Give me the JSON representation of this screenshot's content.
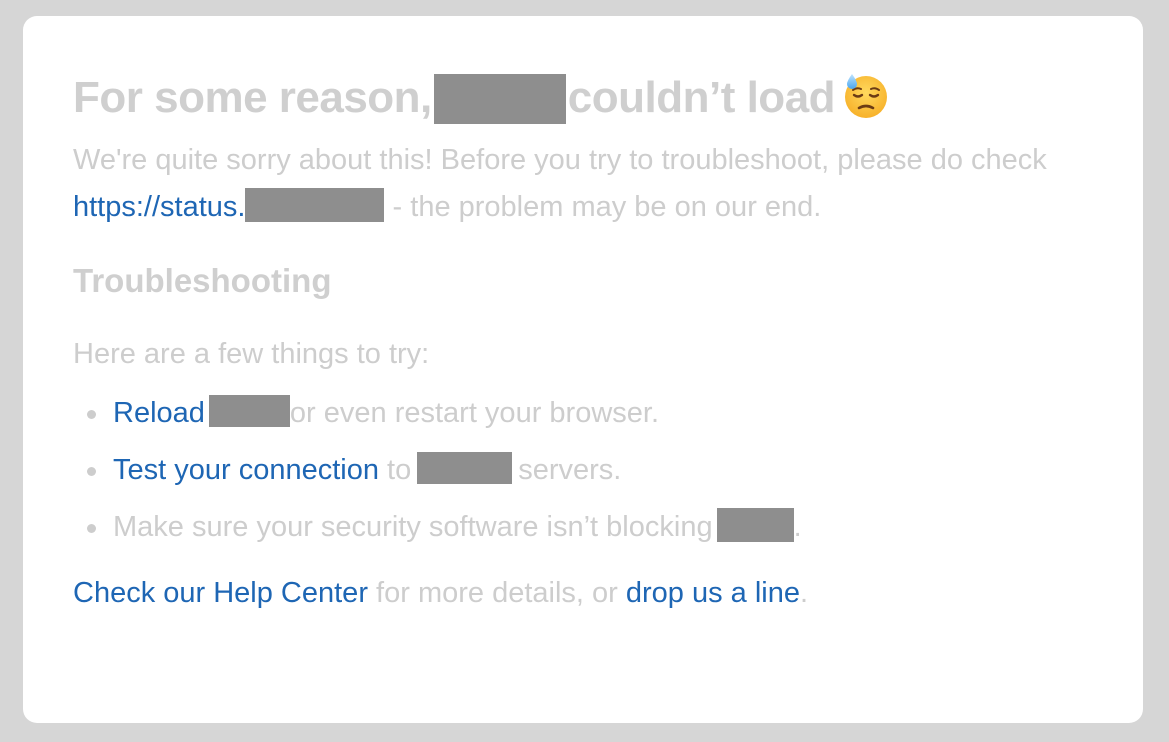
{
  "error": {
    "title_prefix": "For some reason,",
    "title_suffix": "couldn’t load",
    "emoji_name": "downcast-face-with-sweat-icon",
    "apology_text": "We're quite sorry about this! Before you try to troubleshoot, please do check",
    "status_link": "https://status.",
    "apology_suffix": "- the problem may be on our end."
  },
  "troubleshooting": {
    "heading": "Troubleshooting",
    "intro": "Here are a few things to try:",
    "tips": [
      {
        "link": "Reload",
        "text_after": "or even restart your browser."
      },
      {
        "link": "Test your connection",
        "text_mid": "to",
        "text_after": "servers."
      },
      {
        "text_before": "Make sure your security software isn’t blocking",
        "text_after": "."
      }
    ]
  },
  "footer": {
    "help_link": "Check our Help Center",
    "middle_text": "for more details, or",
    "contact_link": "drop us a line",
    "end": "."
  },
  "colors": {
    "link": "#1e66b4",
    "muted_text": "#cdcdcd",
    "redaction": "#8e8e8e"
  }
}
